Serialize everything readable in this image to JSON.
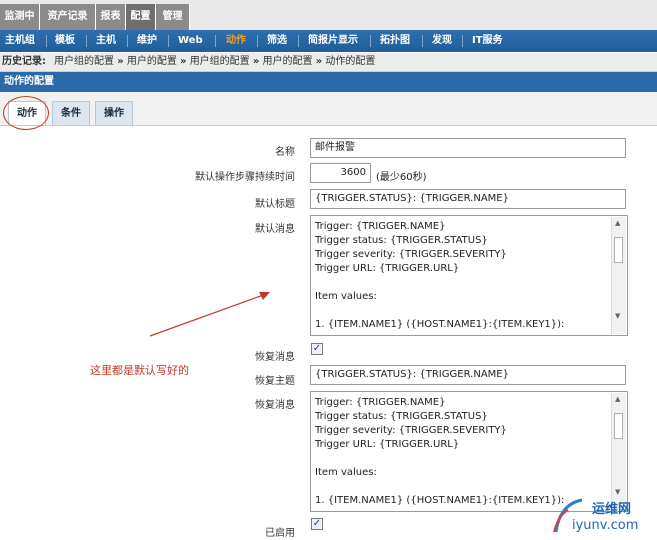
{
  "top_nav": [
    {
      "label": "监测中",
      "active": false
    },
    {
      "label": "资产记录",
      "active": false
    },
    {
      "label": "报表",
      "active": false
    },
    {
      "label": "配置",
      "active": true
    },
    {
      "label": "管理",
      "active": false
    }
  ],
  "sub_nav": [
    {
      "label": "主机组",
      "active": false
    },
    {
      "label": "模板",
      "active": false
    },
    {
      "label": "主机",
      "active": false
    },
    {
      "label": "维护",
      "active": false
    },
    {
      "label": "Web",
      "active": false
    },
    {
      "label": "动作",
      "active": true
    },
    {
      "label": "筛选",
      "active": false
    },
    {
      "label": "简报片显示",
      "active": false
    },
    {
      "label": "拓扑图",
      "active": false
    },
    {
      "label": "发现",
      "active": false
    },
    {
      "label": "IT服务",
      "active": false
    }
  ],
  "history": {
    "label": "历史记录:",
    "items": [
      "用户组的配置",
      "用户的配置",
      "用户组的配置",
      "用户的配置",
      "动作的配置"
    ],
    "separator": "»"
  },
  "section_title": "动作的配置",
  "tabs": [
    {
      "label": "动作",
      "active": true
    },
    {
      "label": "条件",
      "active": false
    },
    {
      "label": "操作",
      "active": false
    }
  ],
  "form": {
    "name_label": "名称",
    "name_value": "邮件报警",
    "step_label": "默认操作步骤持续时间",
    "step_value": "3600",
    "step_hint": "(最少60秒)",
    "subject_label": "默认标题",
    "subject_value": "{TRIGGER.STATUS}: {TRIGGER.NAME}",
    "message_label": "默认消息",
    "message_lines": [
      "Trigger: {TRIGGER.NAME}",
      "Trigger status: {TRIGGER.STATUS}",
      "Trigger severity: {TRIGGER.SEVERITY}",
      "Trigger URL: {TRIGGER.URL}",
      "",
      "Item values:",
      "",
      "1. {ITEM.NAME1} ({HOST.NAME1}:{ITEM.KEY1}):"
    ],
    "recovery_label": "恢复消息",
    "recovery_checked": true,
    "recovery_subject_label": "恢复主题",
    "recovery_subject_value": "{TRIGGER.STATUS}: {TRIGGER.NAME}",
    "recovery_message_label": "恢复消息",
    "recovery_message_lines": [
      "Trigger: {TRIGGER.NAME}",
      "Trigger status: {TRIGGER.STATUS}",
      "Trigger severity: {TRIGGER.SEVERITY}",
      "Trigger URL: {TRIGGER.URL}",
      "",
      "Item values:",
      "",
      "1. {ITEM.NAME1} ({HOST.NAME1}:{ITEM.KEY1}):"
    ],
    "enabled_label": "已启用",
    "enabled_checked": true
  },
  "annotation": "这里都是默认写好的",
  "watermark": {
    "brand": "运维网",
    "domain": "iyunv.com"
  },
  "colors": {
    "nav_blue": "#205d9a",
    "active_orange": "#f0a020",
    "annotation_red": "#c0392b"
  }
}
